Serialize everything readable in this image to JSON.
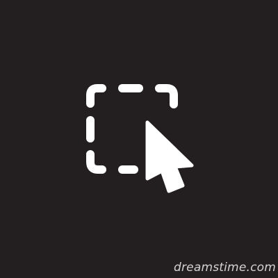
{
  "icon": {
    "name": "select-area-cursor-icon",
    "background": "#231f20",
    "foreground": "#ffffff"
  },
  "watermark": {
    "text": "dreamstime.com"
  }
}
